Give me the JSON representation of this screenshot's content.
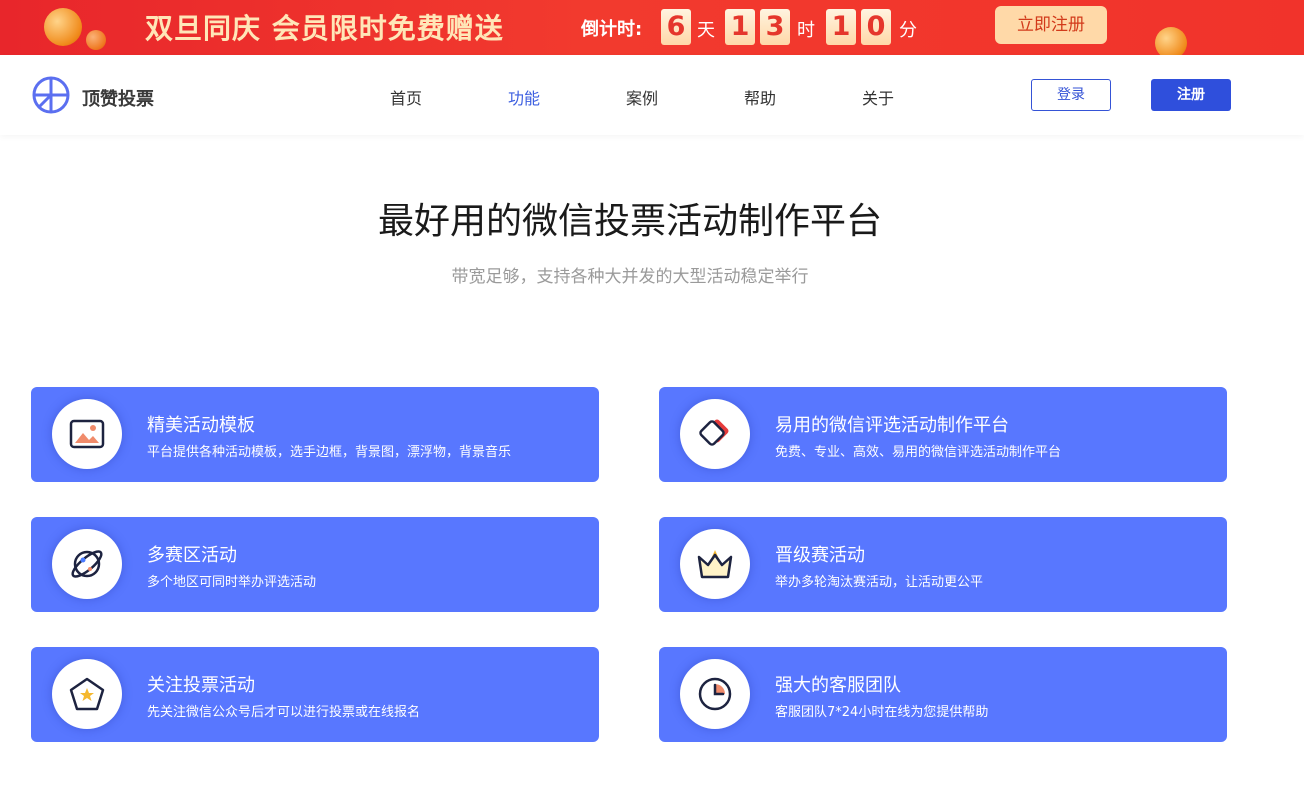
{
  "promo": {
    "title": "双旦同庆 会员限时免费赠送",
    "countdown_label": "倒计时:",
    "days": "6",
    "day_unit": "天",
    "hour_tens": "1",
    "hour_ones": "3",
    "hour_unit": "时",
    "min_tens": "1",
    "min_ones": "0",
    "min_unit": "分",
    "cta": "立即注册"
  },
  "header": {
    "brand": "顶赞投票",
    "nav": [
      "首页",
      "功能",
      "案例",
      "帮助",
      "关于"
    ],
    "active_nav": "功能",
    "login": "登录",
    "register": "注册"
  },
  "hero": {
    "title": "最好用的微信投票活动制作平台",
    "subtitle": "带宽足够，支持各种大并发的大型活动稳定举行"
  },
  "features": [
    {
      "icon": "picture-icon",
      "title": "精美活动模板",
      "desc": "平台提供各种活动模板，选手边框，背景图，漂浮物，背景音乐"
    },
    {
      "icon": "diamond-icon",
      "title": "易用的微信评选活动制作平台",
      "desc": "免费、专业、高效、易用的微信评选活动制作平台"
    },
    {
      "icon": "planet-icon",
      "title": "多赛区活动",
      "desc": "多个地区可同时举办评选活动"
    },
    {
      "icon": "crown-icon",
      "title": "晋级赛活动",
      "desc": "举办多轮淘汰赛活动，让活动更公平"
    },
    {
      "icon": "pentagon-star-icon",
      "title": "关注投票活动",
      "desc": "先关注微信公众号后才可以进行投票或在线报名"
    },
    {
      "icon": "clock-icon",
      "title": "强大的客服团队",
      "desc": "客服团队7*24小时在线为您提供帮助"
    }
  ],
  "colors": {
    "banner_red": "#f1332b",
    "brand_blue": "#2f4fdc",
    "card_blue": "#5877ff"
  }
}
